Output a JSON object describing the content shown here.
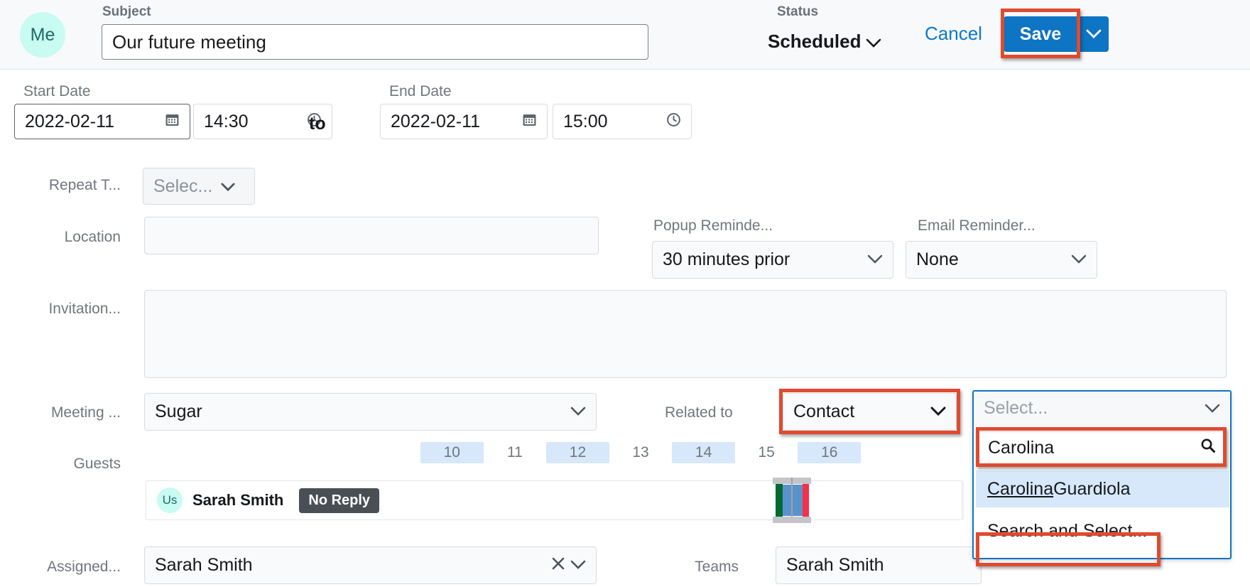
{
  "header": {
    "avatar_initials": "Me",
    "subject_label": "Subject",
    "subject_value": "Our future meeting",
    "status_label": "Status",
    "status_value": "Scheduled",
    "cancel_label": "Cancel",
    "save_label": "Save"
  },
  "dates": {
    "start_label": "Start Date",
    "start_date": "2022-02-11",
    "start_time": "14:30",
    "to_word": "to",
    "end_label": "End Date",
    "end_date": "2022-02-11",
    "end_time": "15:00"
  },
  "repeat": {
    "label": "Repeat T...",
    "value": "Selec..."
  },
  "location": {
    "label": "Location",
    "value": ""
  },
  "reminders": {
    "popup_label": "Popup Reminde...",
    "popup_value": "30 minutes prior",
    "email_label": "Email Reminder...",
    "email_value": "None"
  },
  "invitation": {
    "label": "Invitation...",
    "value": ""
  },
  "meeting_type": {
    "label": "Meeting ...",
    "value": "Sugar"
  },
  "related_to": {
    "label": "Related to",
    "module_value": "Contact",
    "record_placeholder": "Select..."
  },
  "record_dropdown": {
    "header_placeholder": "Select...",
    "search_value": "Carolina",
    "search_icon": "search-icon",
    "result_match": "Carolina",
    "result_rest": " Guardiola",
    "footer_label": "Search and Select..."
  },
  "guests": {
    "label": "Guests",
    "hours": [
      "10",
      "11",
      "12",
      "13",
      "14",
      "15",
      "16"
    ],
    "rows": [
      {
        "avatar_initials": "Us",
        "name": "Sarah Smith",
        "reply_status": "No Reply"
      }
    ]
  },
  "assigned": {
    "label": "Assigned...",
    "value": "Sarah Smith"
  },
  "teams": {
    "label": "Teams",
    "value": "Sarah Smith"
  },
  "colors": {
    "accent_blue": "#0e74c4",
    "link_blue": "#0a79d0",
    "highlight_red": "#e04a2f",
    "avatar_teal": "#c8fbf1",
    "hour_band": "#d6e8fa",
    "busy_green": "#046a33",
    "busy_blue": "#5a92cc",
    "busy_red": "#f5304a"
  }
}
